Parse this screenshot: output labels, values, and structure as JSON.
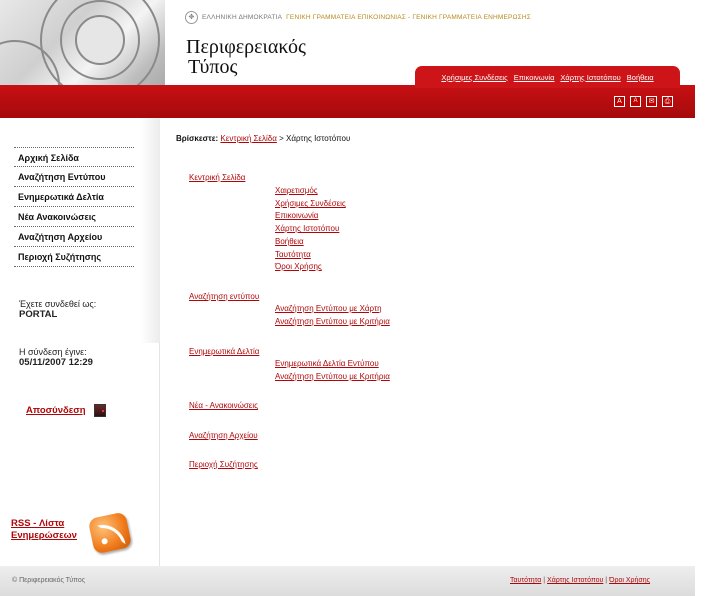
{
  "header": {
    "gov_text": "ΕΛΛΗΝΙΚΗ ΔΗΜΟΚΡΑΤΙΑ",
    "gov_secretariat": "ΓΕΝΙΚΗ ΓΡΑΜΜΑΤΕΙΑ ΕΠΙΚΟΙΝΩΝΙΑΣ - ΓΕΝΙΚΗ ΓΡΑΜΜΑΤΕΙΑ ΕΝΗΜΕΡΩΣΗΣ",
    "title_line1": "Περιφερειακός",
    "title_line2": "Τύπος",
    "top_links": [
      "Χρήσιμες Συνδέσεις",
      "Επικοινωνία",
      "Χάρτης Ιστοτόπου",
      "Βοήθεια"
    ],
    "tools": [
      "A",
      "A",
      "✉",
      "⎙"
    ]
  },
  "sidebar": {
    "menu": [
      "Αρχική Σελίδα",
      "Αναζήτηση Εντύπου",
      "Ενημερωτικά Δελτία",
      "Νέα Ανακοινώσεις",
      "Αναζήτηση Αρχείου",
      "Περιοχή Συζήτησης"
    ],
    "connected_label": "Έχετε συνδεθεί ως:",
    "connected_user": "PORTAL",
    "login_label": "Η σύνδεση έγινε:",
    "login_time": "05/11/2007 12:29",
    "logout": "Αποσύνδεση",
    "rss_line1": "RSS - Λίστα",
    "rss_line2": "Ενημερώσεων"
  },
  "breadcrumb": {
    "label": "Βρίσκεστε:",
    "home": "Κεντρική Σελίδα",
    "current": "> Χάρτης Ιστοτόπου"
  },
  "sitemap": [
    {
      "label": "Κεντρική Σελίδα",
      "children": [
        "Χαιρετισμός",
        "Χρήσιμες Συνδέσεις",
        "Επικοινωνία",
        "Χάρτης Ιστοτόπου",
        "Βοήθεια",
        "Ταυτότητα",
        "Όροι Χρήσης"
      ]
    },
    {
      "label": "Αναζήτηση εντύπου",
      "children": [
        "Αναζήτηση Εντύπου με Χάρτη",
        "Αναζήτηση Εντύπου με Κριτήρια"
      ]
    },
    {
      "label": "Ενημερωτικά Δελτία",
      "children": [
        "Ενημερωτικά Δελτία Εντύπου",
        "Αναζήτηση Εντύπου με Κριτήρια"
      ]
    },
    {
      "label": "Νέα - Ανακοινώσεις",
      "children": []
    },
    {
      "label": "Αναζήτηση Αρχείου",
      "children": []
    },
    {
      "label": "Περιοχή Συζήτησης",
      "children": []
    }
  ],
  "footer": {
    "copyright": "© Περιφερειακός Τύπος",
    "links": [
      "Ταυτότητα",
      "Χάρτης Ιστοτόπου",
      "Όροι Χρήσης"
    ]
  }
}
